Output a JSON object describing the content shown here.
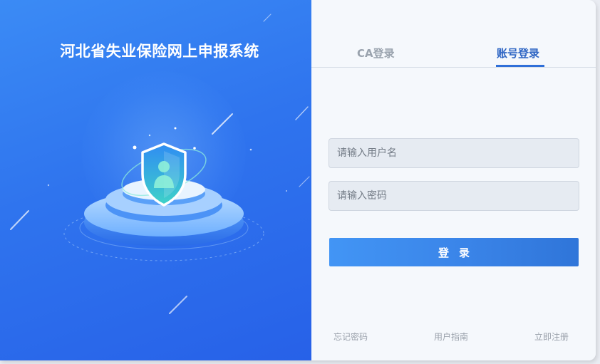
{
  "hero": {
    "title": "河北省失业保险网上申报系统",
    "accent_color": "#2f74ee"
  },
  "tabs": {
    "ca_label": "CA登录",
    "account_label": "账号登录",
    "active": "account"
  },
  "form": {
    "username_placeholder": "请输入用户名",
    "password_placeholder": "请输入密码",
    "username_value": "",
    "password_value": "",
    "login_label": "登录"
  },
  "links": {
    "forgot_password": "忘记密码",
    "user_guide": "用户指南",
    "register": "立即注册"
  },
  "colors": {
    "tab_active": "#2f66c4",
    "tab_inactive": "#9aa3ae",
    "button": "#3a84e8"
  }
}
